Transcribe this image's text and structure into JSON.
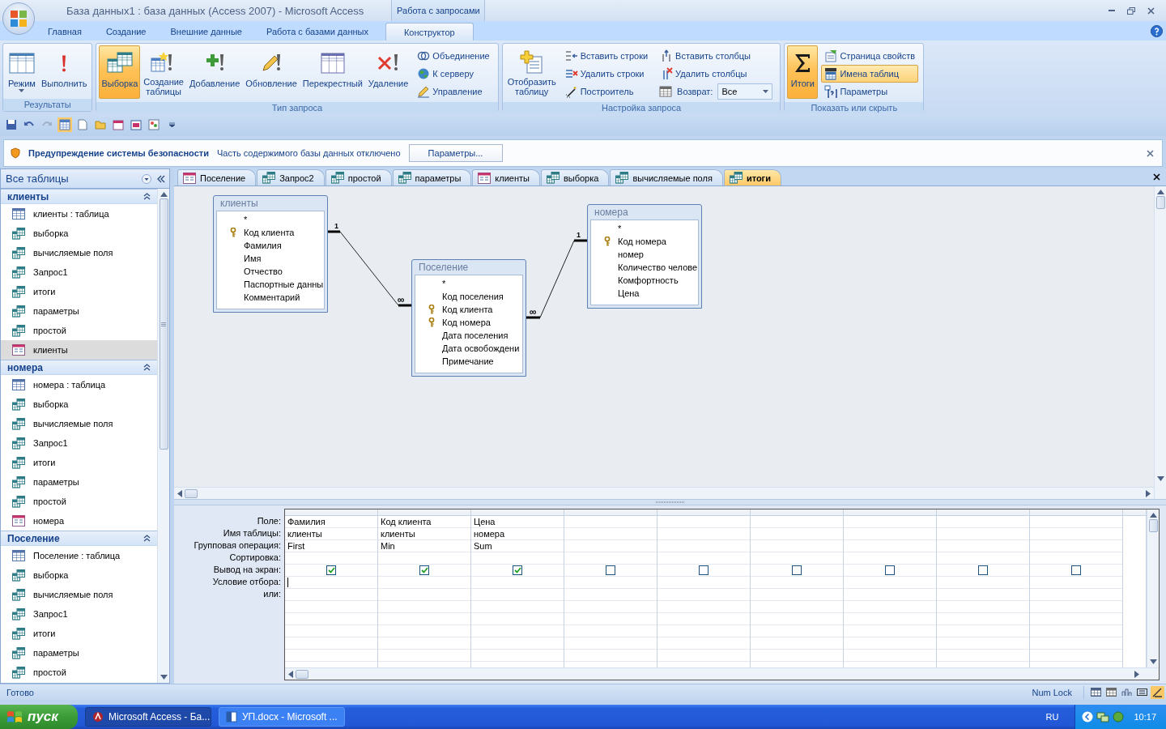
{
  "window": {
    "title": "База данных1 : база данных (Access 2007) - Microsoft Access",
    "context_tab": "Работа с запросами"
  },
  "ribbon_tabs": [
    {
      "label": "Главная",
      "selected": false
    },
    {
      "label": "Создание",
      "selected": false
    },
    {
      "label": "Внешние данные",
      "selected": false
    },
    {
      "label": "Работа с базами данных",
      "selected": false
    },
    {
      "label": "Конструктор",
      "selected": true
    }
  ],
  "ribbon_groups": [
    {
      "title": "Результаты",
      "items": [
        {
          "kind": "large",
          "label": "Режим",
          "selected": false,
          "menu": true
        },
        {
          "kind": "large",
          "label": "Выполнить",
          "selected": false,
          "menu": false
        }
      ]
    },
    {
      "title": "Тип запроса",
      "items": [
        {
          "kind": "large",
          "label": "Выборка",
          "selected": true,
          "menu": false
        },
        {
          "kind": "large",
          "label": "Создание\nтаблицы",
          "selected": false,
          "menu": false
        },
        {
          "kind": "large",
          "label": "Добавление",
          "selected": false,
          "menu": false
        },
        {
          "kind": "large",
          "label": "Обновление",
          "selected": false,
          "menu": false
        },
        {
          "kind": "large",
          "label": "Перекрестный",
          "selected": false,
          "menu": false
        },
        {
          "kind": "large",
          "label": "Удаление",
          "selected": false,
          "menu": false
        },
        {
          "kind": "small",
          "label": "Объединение",
          "selected": false
        },
        {
          "kind": "small",
          "label": "К серверу",
          "selected": false
        },
        {
          "kind": "small",
          "label": "Управление",
          "selected": false
        }
      ]
    },
    {
      "title": "Настройка запроса",
      "items": [
        {
          "kind": "large",
          "label": "Отобразить\nтаблицу",
          "selected": false,
          "menu": false
        },
        {
          "kind": "small",
          "label": "Вставить строки",
          "selected": false
        },
        {
          "kind": "small",
          "label": "Удалить строки",
          "selected": false
        },
        {
          "kind": "small",
          "label": "Построитель",
          "selected": false
        },
        {
          "kind": "small",
          "label": "Вставить столбцы",
          "selected": false
        },
        {
          "kind": "small",
          "label": "Удалить столбцы",
          "selected": false
        },
        {
          "kind": "combo",
          "label": "Возврат:",
          "value": "Все"
        }
      ]
    },
    {
      "title": "Показать или скрыть",
      "items": [
        {
          "kind": "large",
          "label": "Итоги",
          "selected": true,
          "menu": false
        },
        {
          "kind": "small",
          "label": "Страница свойств",
          "selected": false
        },
        {
          "kind": "small",
          "label": "Имена таблиц",
          "selected": true
        },
        {
          "kind": "small",
          "label": "Параметры",
          "selected": false
        }
      ]
    }
  ],
  "security_bar": {
    "title": "Предупреждение системы безопасности",
    "message": "Часть содержимого базы данных отключено",
    "button": "Параметры..."
  },
  "nav_pane": {
    "header": "Все таблицы",
    "groups": [
      {
        "title": "клиенты",
        "expanded": true,
        "items": [
          {
            "kind": "table",
            "label": "клиенты : таблица",
            "selected": false
          },
          {
            "kind": "query",
            "label": "выборка",
            "selected": false
          },
          {
            "kind": "query",
            "label": "вычисляемые поля",
            "selected": false
          },
          {
            "kind": "query",
            "label": "Запрос1",
            "selected": false
          },
          {
            "kind": "query",
            "label": "итоги",
            "selected": false
          },
          {
            "kind": "query",
            "label": "параметры",
            "selected": false
          },
          {
            "kind": "query",
            "label": "простой",
            "selected": false
          },
          {
            "kind": "form",
            "label": "клиенты",
            "selected": true
          }
        ]
      },
      {
        "title": "номера",
        "expanded": true,
        "items": [
          {
            "kind": "table",
            "label": "номера : таблица",
            "selected": false
          },
          {
            "kind": "query",
            "label": "выборка",
            "selected": false
          },
          {
            "kind": "query",
            "label": "вычисляемые поля",
            "selected": false
          },
          {
            "kind": "query",
            "label": "Запрос1",
            "selected": false
          },
          {
            "kind": "query",
            "label": "итоги",
            "selected": false
          },
          {
            "kind": "query",
            "label": "параметры",
            "selected": false
          },
          {
            "kind": "query",
            "label": "простой",
            "selected": false
          },
          {
            "kind": "form",
            "label": "номера",
            "selected": false
          }
        ]
      },
      {
        "title": "Поселение",
        "expanded": true,
        "items": [
          {
            "kind": "table",
            "label": "Поселение : таблица",
            "selected": false
          },
          {
            "kind": "query",
            "label": "выборка",
            "selected": false
          },
          {
            "kind": "query",
            "label": "вычисляемые поля",
            "selected": false
          },
          {
            "kind": "query",
            "label": "Запрос1",
            "selected": false
          },
          {
            "kind": "query",
            "label": "итоги",
            "selected": false
          },
          {
            "kind": "query",
            "label": "параметры",
            "selected": false
          },
          {
            "kind": "query",
            "label": "простой",
            "selected": false
          }
        ]
      }
    ]
  },
  "document_tabs": [
    {
      "kind": "form",
      "label": "Поселение",
      "selected": false
    },
    {
      "kind": "query",
      "label": "Запрос2",
      "selected": false
    },
    {
      "kind": "query",
      "label": "простой",
      "selected": false
    },
    {
      "kind": "query",
      "label": "параметры",
      "selected": false
    },
    {
      "kind": "form",
      "label": "клиенты",
      "selected": false
    },
    {
      "kind": "query",
      "label": "выборка",
      "selected": false
    },
    {
      "kind": "query",
      "label": "вычисляемые поля",
      "selected": false
    },
    {
      "kind": "query",
      "label": "итоги",
      "selected": true
    }
  ],
  "design_tables": [
    {
      "name": "клиенты",
      "fields": [
        {
          "name": "*",
          "key": false
        },
        {
          "name": "Код клиента",
          "key": true
        },
        {
          "name": "Фамилия",
          "key": false
        },
        {
          "name": "Имя",
          "key": false
        },
        {
          "name": "Отчество",
          "key": false
        },
        {
          "name": "Паспортные данны",
          "key": false
        },
        {
          "name": "Комментарий",
          "key": false
        }
      ]
    },
    {
      "name": "Поселение",
      "fields": [
        {
          "name": "*",
          "key": false
        },
        {
          "name": "Код поселения",
          "key": false
        },
        {
          "name": "Код клиента",
          "key": true
        },
        {
          "name": "Код номера",
          "key": true
        },
        {
          "name": "Дата поселения",
          "key": false
        },
        {
          "name": "Дата освобождени",
          "key": false
        },
        {
          "name": "Примечание",
          "key": false
        }
      ]
    },
    {
      "name": "номера",
      "fields": [
        {
          "name": "*",
          "key": false
        },
        {
          "name": "Код номера",
          "key": true
        },
        {
          "name": "номер",
          "key": false
        },
        {
          "name": "Количество челове",
          "key": false
        },
        {
          "name": "Комфортность",
          "key": false
        },
        {
          "name": "Цена",
          "key": false
        }
      ]
    }
  ],
  "relationships": [
    {
      "one": "1",
      "many": "∞"
    },
    {
      "one": "1",
      "many": "∞"
    }
  ],
  "query_grid": {
    "row_labels": [
      "Поле:",
      "Имя таблицы:",
      "Групповая операция:",
      "Сортировка:",
      "Вывод на экран:",
      "Условие отбора:",
      "или:"
    ],
    "columns": [
      {
        "field": "Фамилия",
        "table": "клиенты",
        "total": "First",
        "show": true
      },
      {
        "field": "Код клиента",
        "table": "клиенты",
        "total": "Min",
        "show": true
      },
      {
        "field": "Цена",
        "table": "номера",
        "total": "Sum",
        "show": true
      },
      {
        "show": false
      },
      {
        "show": false
      },
      {
        "show": false
      },
      {
        "show": false
      },
      {
        "show": false
      },
      {
        "show": false
      }
    ]
  },
  "status_bar": {
    "left": "Готово",
    "right": "Num Lock"
  },
  "taskbar": {
    "start": "пуск",
    "tasks": [
      {
        "label": "Microsoft Access - Ба...",
        "selected": true
      },
      {
        "label": "УП.docx - Microsoft ...",
        "selected": false
      }
    ],
    "language": "RU",
    "clock": "10:17"
  }
}
